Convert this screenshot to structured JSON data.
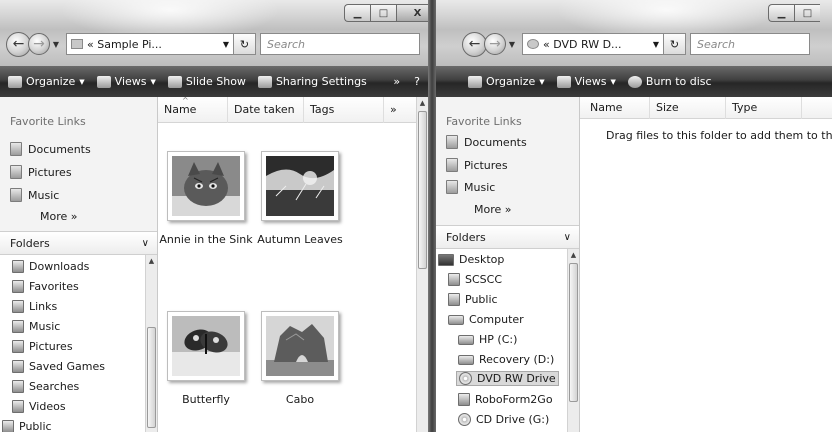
{
  "left_window": {
    "address": "« Sample Pi...",
    "search_placeholder": "Search",
    "toolbar": [
      "Organize",
      "Views",
      "Slide Show",
      "Sharing Settings"
    ],
    "toolbar_more": "»",
    "help": "?",
    "favorites_title": "Favorite Links",
    "favorites": [
      "Documents",
      "Pictures",
      "Music"
    ],
    "more_label": "More »",
    "folders_label": "Folders",
    "tree": [
      "Downloads",
      "Favorites",
      "Links",
      "Music",
      "Pictures",
      "Saved Games",
      "Searches",
      "Videos",
      "Public"
    ],
    "columns": [
      "Name",
      "Date taken",
      "Tags"
    ],
    "columns_more": "»",
    "files": [
      "Annie in the Sink",
      "Autumn Leaves",
      "Butterfly",
      "Cabo"
    ]
  },
  "right_window": {
    "address": "« DVD RW D...",
    "search_placeholder": "Search",
    "toolbar": [
      "Organize",
      "Views",
      "Burn to disc"
    ],
    "favorites_title": "Favorite Links",
    "favorites": [
      "Documents",
      "Pictures",
      "Music"
    ],
    "more_label": "More »",
    "folders_label": "Folders",
    "tree": [
      "Desktop",
      "SCSCC",
      "Public",
      "Computer",
      "HP (C:)",
      "Recovery (D:)",
      "DVD RW Drive",
      "RoboForm2Go",
      "CD Drive (G:)"
    ],
    "columns": [
      "Name",
      "Size",
      "Type"
    ],
    "empty_message": "Drag files to this folder to add them to the disc."
  },
  "icons": {
    "back": "back-arrow-icon",
    "forward": "forward-arrow-icon",
    "refresh": "refresh-icon",
    "close": "close-icon",
    "minimize": "minimize-icon",
    "maximize": "maximize-icon"
  }
}
